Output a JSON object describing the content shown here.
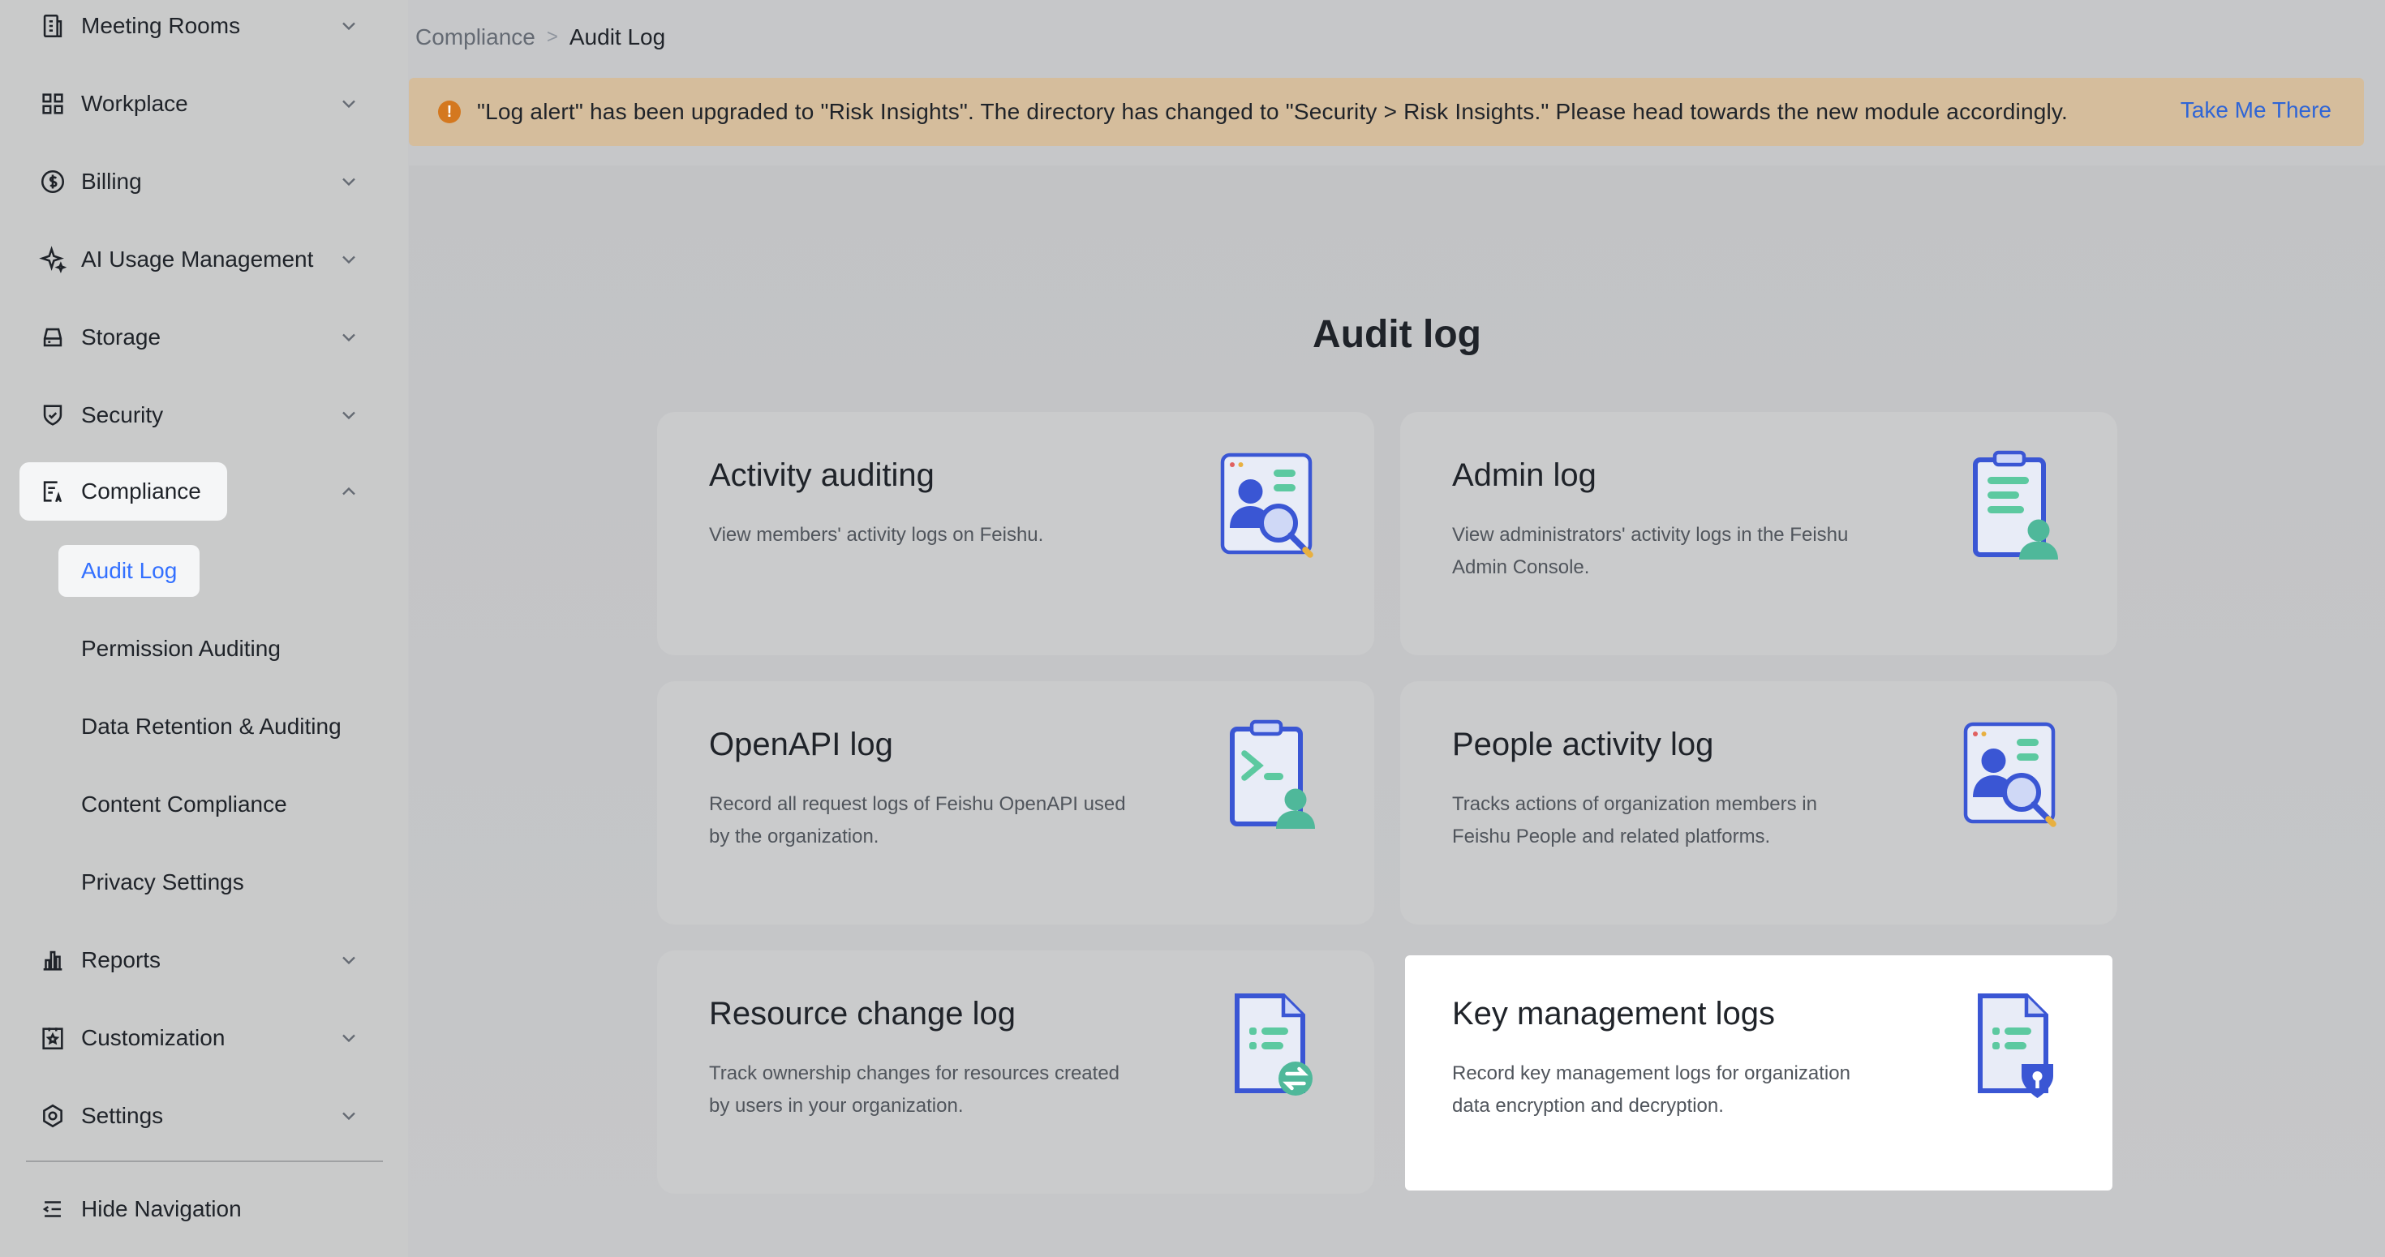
{
  "sidebar": {
    "items": [
      {
        "label": "Meeting Rooms"
      },
      {
        "label": "Workplace"
      },
      {
        "label": "Billing"
      },
      {
        "label": "AI Usage Management"
      },
      {
        "label": "Storage"
      },
      {
        "label": "Security"
      },
      {
        "label": "Compliance"
      },
      {
        "label": "Reports"
      },
      {
        "label": "Customization"
      },
      {
        "label": "Settings"
      }
    ],
    "compliance_sub": [
      {
        "label": "Audit Log"
      },
      {
        "label": "Permission Auditing"
      },
      {
        "label": "Data Retention & Auditing"
      },
      {
        "label": "Content Compliance"
      },
      {
        "label": "Privacy Settings"
      }
    ],
    "hide_navigation": "Hide Navigation"
  },
  "breadcrumb": {
    "parent": "Compliance",
    "separator": ">",
    "current": "Audit Log"
  },
  "banner": {
    "icon": "!",
    "text": "\"Log alert\" has been upgraded to \"Risk Insights\". The directory has changed to \"Security > Risk Insights.\" Please head towards the new module accordingly.",
    "link": "Take Me There"
  },
  "main": {
    "title": "Audit log",
    "cards": [
      {
        "title": "Activity auditing",
        "desc": "View members' activity logs on Feishu."
      },
      {
        "title": "Admin log",
        "desc": "View administrators' activity logs in the Feishu Admin Console."
      },
      {
        "title": "OpenAPI log",
        "desc": "Record all request logs of Feishu OpenAPI used by the organization."
      },
      {
        "title": "People activity log",
        "desc": "Tracks actions of organization members in Feishu People and related platforms."
      },
      {
        "title": "Resource change log",
        "desc": "Track ownership changes for resources created by users in your organization."
      },
      {
        "title": "Key management logs",
        "desc": "Record key management logs for organization data encryption and decryption."
      }
    ]
  },
  "colors": {
    "accent": "#3370ff",
    "banner_bg": "#d5bd9c",
    "warning": "#d4781f"
  }
}
